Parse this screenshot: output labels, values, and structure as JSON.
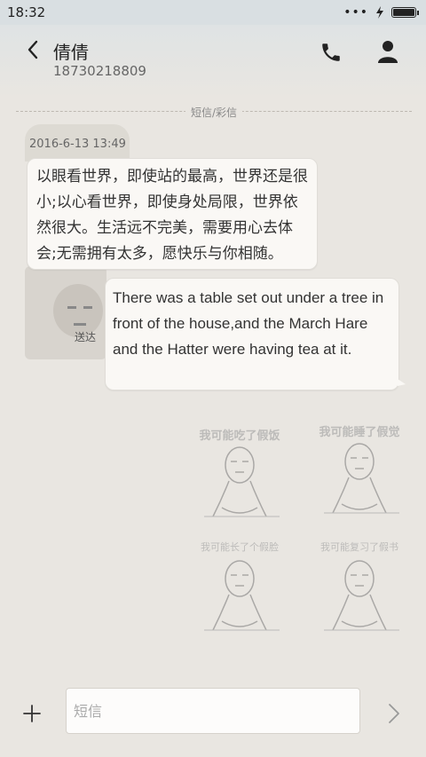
{
  "status_bar": {
    "time": "18:32",
    "icons": [
      "more-icon",
      "charging-icon",
      "battery-icon"
    ]
  },
  "header": {
    "contact_name": "倩倩",
    "contact_number": "18730218809",
    "actions": [
      "call-icon",
      "contact-icon"
    ]
  },
  "thread": {
    "divider_label": "短信/彩信",
    "timestamp": "2016-6-13 13:49",
    "messages": [
      {
        "direction": "incoming",
        "text": "以眼看世界，即使站的最高，世界还是很小;以心看世界，即使身处局限，世界依然很大。生活远不完美，需要用心去体会;无需拥有太多，愿快乐与你相随。"
      },
      {
        "direction": "outgoing",
        "text": "There was a table set out under a tree in front of the house,and the March Hare and the Hatter were having tea at it.",
        "status": "送达"
      }
    ]
  },
  "wallpaper": {
    "captions": [
      "我可能吃了假饭",
      "我可能睡了假觉",
      "我可能长了个假脸",
      "我可能复习了假书"
    ]
  },
  "composer": {
    "placeholder": "短信",
    "value": ""
  },
  "colors": {
    "background": "#e9e6e1",
    "bubble": "#faf8f5",
    "text": "#333333"
  }
}
